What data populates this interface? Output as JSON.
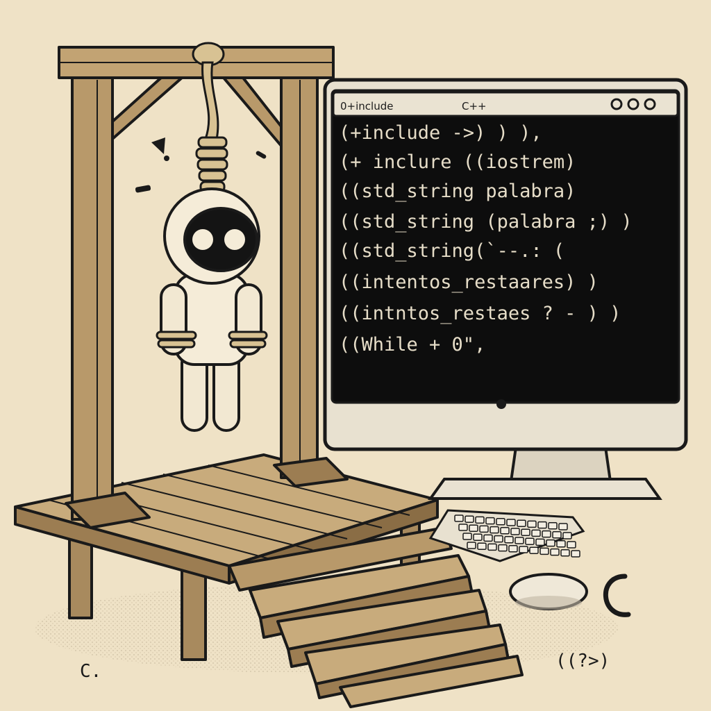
{
  "monitor": {
    "title_left": "0+include",
    "title_center": "C++",
    "window_controls": [
      "circle",
      "circle",
      "circle"
    ]
  },
  "code_lines": [
    "(+include ->)  )       ),",
    "(+ inclure ((iostrem)",
    "((std_string palabra)",
    "((std_string (palabra ;) )",
    "((std_string(`--.:          (",
    "((intentos_restaares) )",
    "((intntos_restaes ? - ) )",
    "((While  + 0\","
  ],
  "doodles": {
    "bottom_right": "((?>)",
    "bottom_left": "C."
  }
}
